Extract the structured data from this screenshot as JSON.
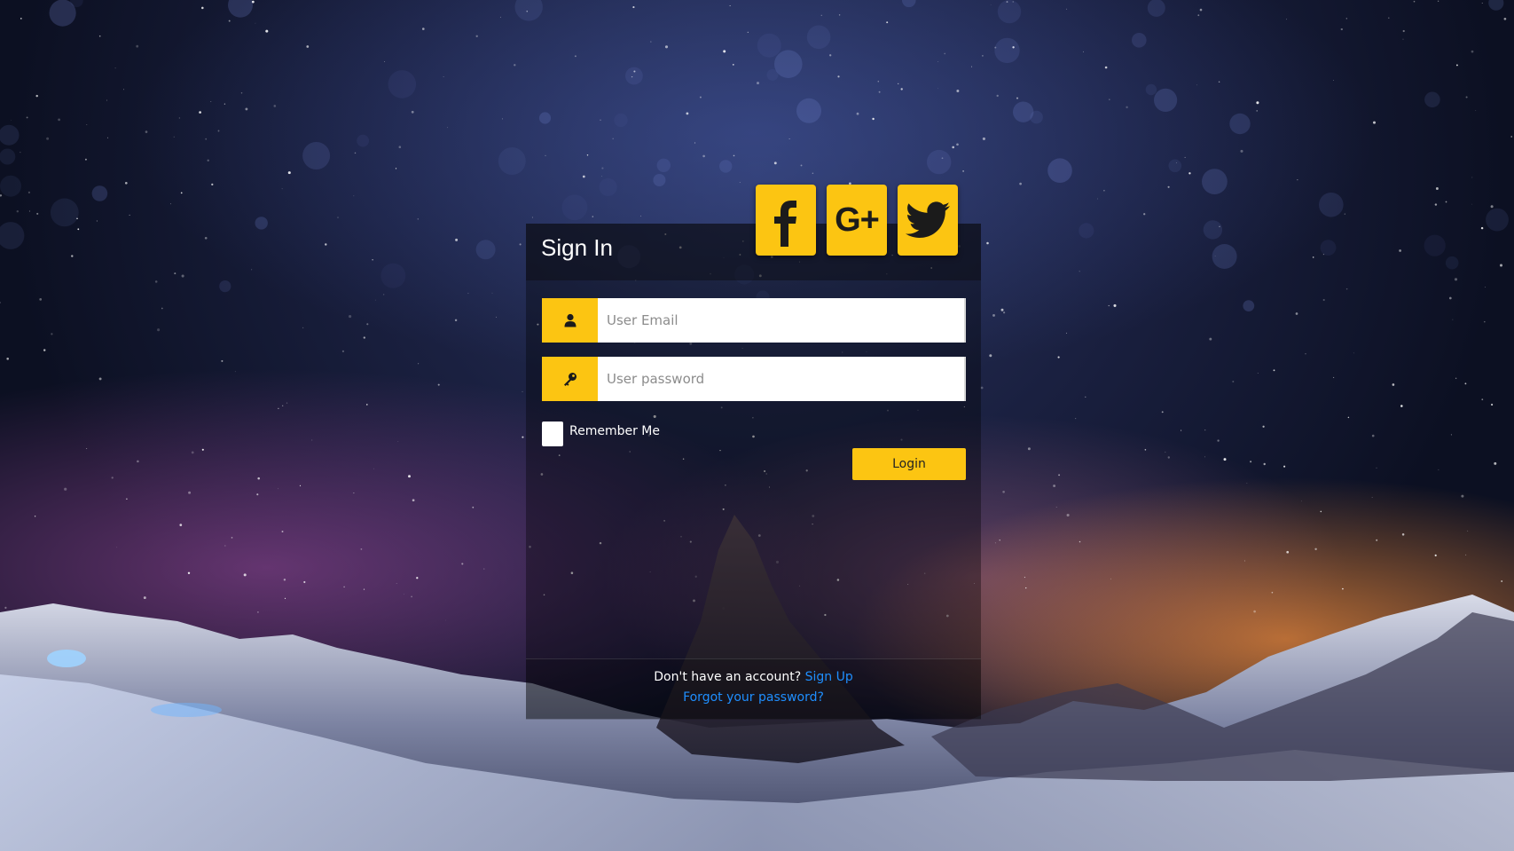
{
  "title": "Sign In",
  "social": {
    "facebook_icon": "facebook-icon",
    "google_plus_label": "G+",
    "twitter_icon": "twitter-icon",
    "accent_color": "#fcc512"
  },
  "form": {
    "email_placeholder": "User Email",
    "email_value": "",
    "password_placeholder": "User password",
    "password_value": "",
    "remember_label": "Remember Me",
    "remember_checked": false,
    "login_label": "Login"
  },
  "footer": {
    "no_account_text": "Don't have an account?",
    "signup_link": "Sign Up",
    "forgot_link": "Forgot your password?",
    "link_color": "#1f8fff"
  }
}
